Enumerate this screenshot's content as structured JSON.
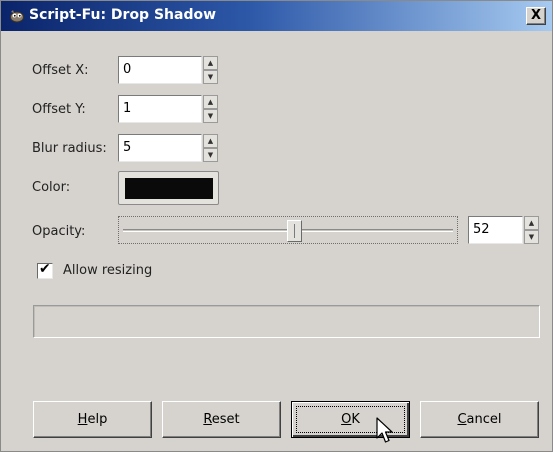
{
  "window": {
    "title": "Script-Fu: Drop Shadow",
    "app_icon": "gimp-wilber-icon",
    "close_label": "X"
  },
  "fields": {
    "offset_x": {
      "label": "Offset X:",
      "value": "0"
    },
    "offset_y": {
      "label": "Offset Y:",
      "value": "1"
    },
    "blur_radius": {
      "label": "Blur radius:",
      "value": "5"
    },
    "color": {
      "label": "Color:",
      "value": "#0a0a0a"
    },
    "opacity": {
      "label": "Opacity:",
      "value": "52",
      "slider_fraction": 0.52
    }
  },
  "options": {
    "allow_resizing": {
      "label": "Allow resizing",
      "checked": true
    }
  },
  "buttons": {
    "help": {
      "pre": "",
      "mnemonic": "H",
      "post": "elp"
    },
    "reset": {
      "pre": "",
      "mnemonic": "R",
      "post": "eset"
    },
    "ok": {
      "pre": "",
      "mnemonic": "O",
      "post": "K"
    },
    "cancel": {
      "pre": "",
      "mnemonic": "C",
      "post": "ancel"
    }
  },
  "colors": {
    "titlebar_start": "#0a246a",
    "titlebar_end": "#a6caf0",
    "dialog_bg": "#d6d3ce"
  }
}
